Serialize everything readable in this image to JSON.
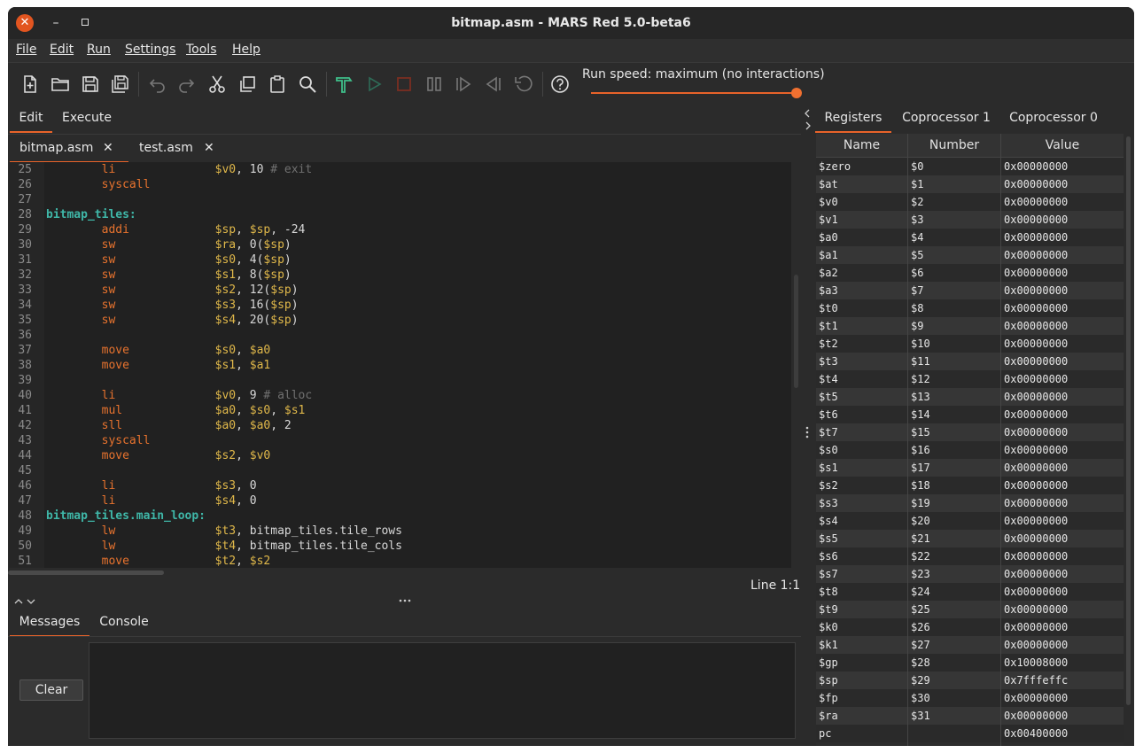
{
  "window": {
    "title": "bitmap.asm - MARS Red 5.0-beta6"
  },
  "menu": [
    "File",
    "Edit",
    "Run",
    "Settings",
    "Tools",
    "Help"
  ],
  "toolbar": {
    "speed_label": "Run speed: maximum (no interactions)",
    "speed_value_fraction": 1.0
  },
  "left_tabs": [
    "Edit",
    "Execute"
  ],
  "file_tabs": [
    {
      "name": "bitmap.asm",
      "close": "✕"
    },
    {
      "name": "test.asm",
      "close": "✕"
    }
  ],
  "editor": {
    "lines": [
      {
        "n": "25",
        "indent": "        ",
        "label": "",
        "op": "li",
        "args": [
          [
            "$v0",
            "reg"
          ],
          [
            ", 10 ",
            ""
          ]
        ],
        "comment": "# exit"
      },
      {
        "n": "26",
        "indent": "        ",
        "label": "",
        "op": "syscall",
        "args": [],
        "comment": ""
      },
      {
        "n": "27",
        "indent": "",
        "label": "",
        "op": "",
        "args": [],
        "comment": ""
      },
      {
        "n": "28",
        "indent": "",
        "label": "bitmap_tiles:",
        "op": "",
        "args": [],
        "comment": ""
      },
      {
        "n": "29",
        "indent": "        ",
        "label": "",
        "op": "addi",
        "args": [
          [
            "$sp",
            "reg"
          ],
          [
            ", ",
            ""
          ],
          [
            "$sp",
            "reg"
          ],
          [
            ", -24",
            ""
          ]
        ],
        "comment": ""
      },
      {
        "n": "30",
        "indent": "        ",
        "label": "",
        "op": "sw",
        "args": [
          [
            "$ra",
            "reg"
          ],
          [
            ", 0(",
            ""
          ],
          [
            "$sp",
            "reg"
          ],
          [
            ")",
            ""
          ]
        ],
        "comment": ""
      },
      {
        "n": "31",
        "indent": "        ",
        "label": "",
        "op": "sw",
        "args": [
          [
            "$s0",
            "reg"
          ],
          [
            ", 4(",
            ""
          ],
          [
            "$sp",
            "reg"
          ],
          [
            ")",
            ""
          ]
        ],
        "comment": ""
      },
      {
        "n": "32",
        "indent": "        ",
        "label": "",
        "op": "sw",
        "args": [
          [
            "$s1",
            "reg"
          ],
          [
            ", 8(",
            ""
          ],
          [
            "$sp",
            "reg"
          ],
          [
            ")",
            ""
          ]
        ],
        "comment": ""
      },
      {
        "n": "33",
        "indent": "        ",
        "label": "",
        "op": "sw",
        "args": [
          [
            "$s2",
            "reg"
          ],
          [
            ", 12(",
            ""
          ],
          [
            "$sp",
            "reg"
          ],
          [
            ")",
            ""
          ]
        ],
        "comment": ""
      },
      {
        "n": "34",
        "indent": "        ",
        "label": "",
        "op": "sw",
        "args": [
          [
            "$s3",
            "reg"
          ],
          [
            ", 16(",
            ""
          ],
          [
            "$sp",
            "reg"
          ],
          [
            ")",
            ""
          ]
        ],
        "comment": ""
      },
      {
        "n": "35",
        "indent": "        ",
        "label": "",
        "op": "sw",
        "args": [
          [
            "$s4",
            "reg"
          ],
          [
            ", 20(",
            ""
          ],
          [
            "$sp",
            "reg"
          ],
          [
            ")",
            ""
          ]
        ],
        "comment": ""
      },
      {
        "n": "36",
        "indent": "",
        "label": "",
        "op": "",
        "args": [],
        "comment": ""
      },
      {
        "n": "37",
        "indent": "        ",
        "label": "",
        "op": "move",
        "args": [
          [
            "$s0",
            "reg"
          ],
          [
            ", ",
            ""
          ],
          [
            "$a0",
            "reg"
          ]
        ],
        "comment": ""
      },
      {
        "n": "38",
        "indent": "        ",
        "label": "",
        "op": "move",
        "args": [
          [
            "$s1",
            "reg"
          ],
          [
            ", ",
            ""
          ],
          [
            "$a1",
            "reg"
          ]
        ],
        "comment": ""
      },
      {
        "n": "39",
        "indent": "",
        "label": "",
        "op": "",
        "args": [],
        "comment": ""
      },
      {
        "n": "40",
        "indent": "        ",
        "label": "",
        "op": "li",
        "args": [
          [
            "$v0",
            "reg"
          ],
          [
            ", 9 ",
            ""
          ]
        ],
        "comment": "# alloc"
      },
      {
        "n": "41",
        "indent": "        ",
        "label": "",
        "op": "mul",
        "args": [
          [
            "$a0",
            "reg"
          ],
          [
            ", ",
            ""
          ],
          [
            "$s0",
            "reg"
          ],
          [
            ", ",
            ""
          ],
          [
            "$s1",
            "reg"
          ]
        ],
        "comment": ""
      },
      {
        "n": "42",
        "indent": "        ",
        "label": "",
        "op": "sll",
        "args": [
          [
            "$a0",
            "reg"
          ],
          [
            ", ",
            ""
          ],
          [
            "$a0",
            "reg"
          ],
          [
            ", 2",
            ""
          ]
        ],
        "comment": ""
      },
      {
        "n": "43",
        "indent": "        ",
        "label": "",
        "op": "syscall",
        "args": [],
        "comment": ""
      },
      {
        "n": "44",
        "indent": "        ",
        "label": "",
        "op": "move",
        "args": [
          [
            "$s2",
            "reg"
          ],
          [
            ", ",
            ""
          ],
          [
            "$v0",
            "reg"
          ]
        ],
        "comment": ""
      },
      {
        "n": "45",
        "indent": "",
        "label": "",
        "op": "",
        "args": [],
        "comment": ""
      },
      {
        "n": "46",
        "indent": "        ",
        "label": "",
        "op": "li",
        "args": [
          [
            "$s3",
            "reg"
          ],
          [
            ", 0",
            ""
          ]
        ],
        "comment": ""
      },
      {
        "n": "47",
        "indent": "        ",
        "label": "",
        "op": "li",
        "args": [
          [
            "$s4",
            "reg"
          ],
          [
            ", 0",
            ""
          ]
        ],
        "comment": ""
      },
      {
        "n": "48",
        "indent": "",
        "label": "bitmap_tiles.main_loop:",
        "op": "",
        "args": [],
        "comment": ""
      },
      {
        "n": "49",
        "indent": "        ",
        "label": "",
        "op": "lw",
        "args": [
          [
            "$t3",
            "reg"
          ],
          [
            ", bitmap_tiles.tile_rows",
            ""
          ]
        ],
        "comment": ""
      },
      {
        "n": "50",
        "indent": "        ",
        "label": "",
        "op": "lw",
        "args": [
          [
            "$t4",
            "reg"
          ],
          [
            ", bitmap_tiles.tile_cols",
            ""
          ]
        ],
        "comment": ""
      },
      {
        "n": "51",
        "indent": "        ",
        "label": "",
        "op": "move",
        "args": [
          [
            "$t2",
            "reg"
          ],
          [
            ", ",
            ""
          ],
          [
            "$s2",
            "reg"
          ]
        ],
        "comment": ""
      }
    ]
  },
  "status": {
    "line_pos": "Line 1:1"
  },
  "message_tabs": [
    "Messages",
    "Console"
  ],
  "clear_button": "Clear",
  "right_tabs": [
    "Registers",
    "Coprocessor 1",
    "Coprocessor 0"
  ],
  "registers": {
    "headers": [
      "Name",
      "Number",
      "Value"
    ],
    "rows": [
      [
        "$zero",
        "$0",
        "0x00000000"
      ],
      [
        "$at",
        "$1",
        "0x00000000"
      ],
      [
        "$v0",
        "$2",
        "0x00000000"
      ],
      [
        "$v1",
        "$3",
        "0x00000000"
      ],
      [
        "$a0",
        "$4",
        "0x00000000"
      ],
      [
        "$a1",
        "$5",
        "0x00000000"
      ],
      [
        "$a2",
        "$6",
        "0x00000000"
      ],
      [
        "$a3",
        "$7",
        "0x00000000"
      ],
      [
        "$t0",
        "$8",
        "0x00000000"
      ],
      [
        "$t1",
        "$9",
        "0x00000000"
      ],
      [
        "$t2",
        "$10",
        "0x00000000"
      ],
      [
        "$t3",
        "$11",
        "0x00000000"
      ],
      [
        "$t4",
        "$12",
        "0x00000000"
      ],
      [
        "$t5",
        "$13",
        "0x00000000"
      ],
      [
        "$t6",
        "$14",
        "0x00000000"
      ],
      [
        "$t7",
        "$15",
        "0x00000000"
      ],
      [
        "$s0",
        "$16",
        "0x00000000"
      ],
      [
        "$s1",
        "$17",
        "0x00000000"
      ],
      [
        "$s2",
        "$18",
        "0x00000000"
      ],
      [
        "$s3",
        "$19",
        "0x00000000"
      ],
      [
        "$s4",
        "$20",
        "0x00000000"
      ],
      [
        "$s5",
        "$21",
        "0x00000000"
      ],
      [
        "$s6",
        "$22",
        "0x00000000"
      ],
      [
        "$s7",
        "$23",
        "0x00000000"
      ],
      [
        "$t8",
        "$24",
        "0x00000000"
      ],
      [
        "$t9",
        "$25",
        "0x00000000"
      ],
      [
        "$k0",
        "$26",
        "0x00000000"
      ],
      [
        "$k1",
        "$27",
        "0x00000000"
      ],
      [
        "$gp",
        "$28",
        "0x10008000"
      ],
      [
        "$sp",
        "$29",
        "0x7fffeffc"
      ],
      [
        "$fp",
        "$30",
        "0x00000000"
      ],
      [
        "$ra",
        "$31",
        "0x00000000"
      ],
      [
        "pc",
        "",
        "0x00400000"
      ]
    ]
  },
  "colors": {
    "accent": "#e8632a",
    "keyword": "#e8732e",
    "label": "#3fb7a8",
    "register": "#e0b84a",
    "comment": "#707070"
  }
}
